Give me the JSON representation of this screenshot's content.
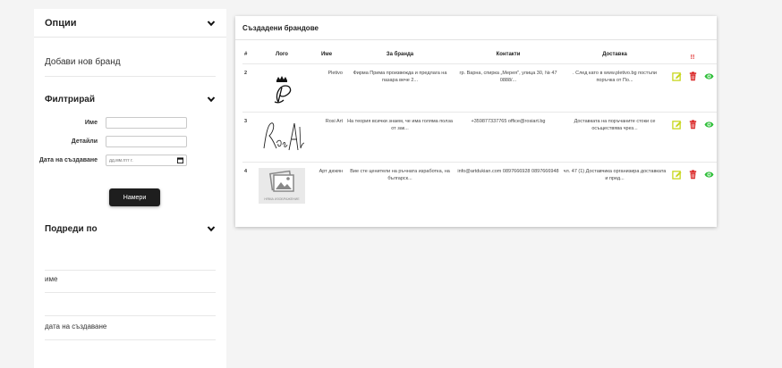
{
  "sidebar": {
    "options_title": "Опции",
    "add_brand": "Добави нов бранд",
    "filter_title": "Филтрирай",
    "filter": {
      "name_label": "Име",
      "details_label": "Детайли",
      "date_label": "Дата на създаване",
      "date_placeholder": "дд.мм.гггг г.",
      "search_button": "Намери"
    },
    "sort_title": "Подреди по",
    "sort_options": [
      "име",
      "дата на създаване"
    ]
  },
  "main": {
    "title": "Създадени брандове",
    "columns": [
      "#",
      "Лого",
      "Име",
      "За бранда",
      "Контакти",
      "Доставка",
      "!!"
    ],
    "rows": [
      {
        "num": "2",
        "logo": "P-crown-logo",
        "name": "Pletivo",
        "about": "Фирма Прима произвежда и предлага на пазара вече 2...",
        "contacts": "гр. Варна, спирка „Мерея\", улица 30, № 47 0888/...",
        "delivery": ". След като в www.pletivo.bg постъпи поръчка от По..."
      },
      {
        "num": "3",
        "logo": "rosi-art-signature-logo",
        "name": "Rosi Art",
        "about": "На теория всички знаем, че има голяма полза от зак...",
        "contacts": "+359877337765 office@rosiart.bg",
        "delivery": "Доставката на поръчаните стоки се осъществява чрез..."
      },
      {
        "num": "4",
        "logo": "no-image-placeholder",
        "name": "Арт дюкян",
        "about": "Вие сте ценители на ръчната изработка, на българск...",
        "contacts": "info@artdukian.com 0897666928 0897666948",
        "delivery": "чл. 47 (1) Доставчика организира доставката и пред..."
      }
    ],
    "placeholder_logo_text": "НЯМА ИЗОБРАЖЕНИЕ",
    "colors": {
      "edit": "#c7d61b",
      "delete": "#d81b1b",
      "view": "#2fbf3a",
      "header_mark": "#e02a2a"
    }
  }
}
